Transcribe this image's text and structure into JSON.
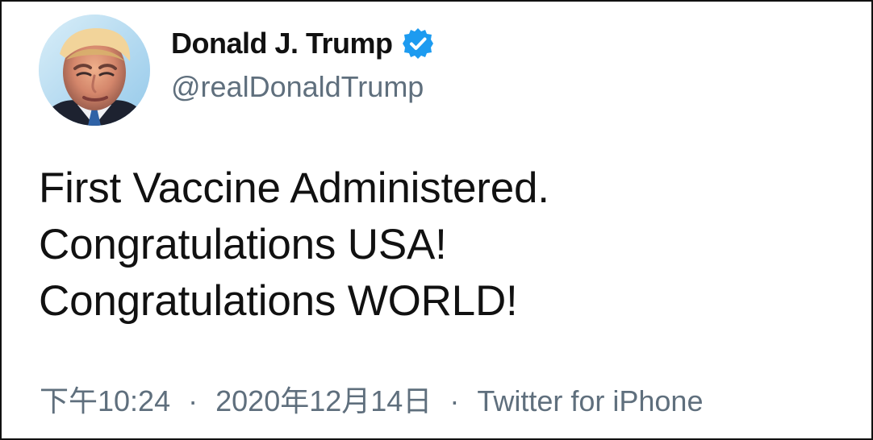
{
  "user": {
    "display_name": "Donald J. Trump",
    "handle": "@realDonaldTrump",
    "verified_icon": "verified-badge-icon",
    "avatar_icon": "profile-photo",
    "verified_color": "#1d9bf0"
  },
  "tweet": {
    "lines": [
      "First Vaccine Administered.",
      "Congratulations USA!",
      "Congratulations WORLD!"
    ]
  },
  "metadata": {
    "time": "下午10:24",
    "separator": "·",
    "date": "2020年12月14日",
    "source": "Twitter for iPhone"
  },
  "colors": {
    "text": "#111111",
    "secondary": "#5f6f7d",
    "background": "#ffffff",
    "frame": "#111111"
  }
}
